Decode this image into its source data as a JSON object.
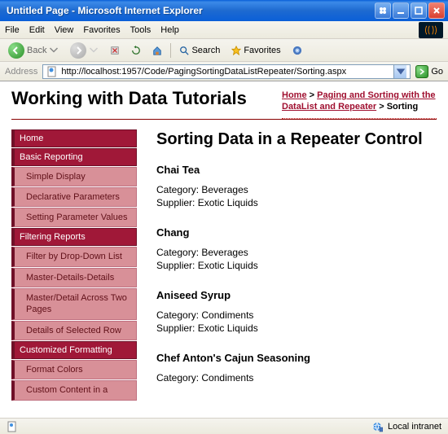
{
  "window": {
    "title": "Untitled Page - Microsoft Internet Explorer"
  },
  "menu": {
    "file": "File",
    "edit": "Edit",
    "view": "View",
    "favorites": "Favorites",
    "tools": "Tools",
    "help": "Help"
  },
  "toolbar": {
    "back": "Back",
    "search": "Search",
    "favorites": "Favorites"
  },
  "address": {
    "label": "Address",
    "url": "http://localhost:1957/Code/PagingSortingDataListRepeater/Sorting.aspx",
    "go": "Go"
  },
  "header": {
    "title": "Working with Data Tutorials"
  },
  "breadcrumb": {
    "home": "Home",
    "section": "Paging and Sorting with the DataList and Repeater",
    "current": "Sorting"
  },
  "nav": {
    "home": "Home",
    "basic_reporting": "Basic Reporting",
    "simple_display": "Simple Display",
    "declarative_params": "Declarative Parameters",
    "setting_param": "Setting Parameter Values",
    "filtering": "Filtering Reports",
    "filter_dd": "Filter by Drop-Down List",
    "master_details": "Master-Details-Details",
    "master_two": "Master/Detail Across Two Pages",
    "details_row": "Details of Selected Row",
    "custom_fmt": "Customized Formatting",
    "format_colors": "Format Colors",
    "custom_content": "Custom Content in a"
  },
  "main": {
    "heading": "Sorting Data in a Repeater Control"
  },
  "products": [
    {
      "name": "Chai Tea",
      "category": "Beverages",
      "supplier": "Exotic Liquids"
    },
    {
      "name": "Chang",
      "category": "Beverages",
      "supplier": "Exotic Liquids"
    },
    {
      "name": "Aniseed Syrup",
      "category": "Condiments",
      "supplier": "Exotic Liquids"
    },
    {
      "name": "Chef Anton's Cajun Seasoning",
      "category": "Condiments",
      "supplier": ""
    }
  ],
  "labels": {
    "category": "Category:",
    "supplier": "Supplier:"
  },
  "status": {
    "zone": "Local intranet"
  }
}
